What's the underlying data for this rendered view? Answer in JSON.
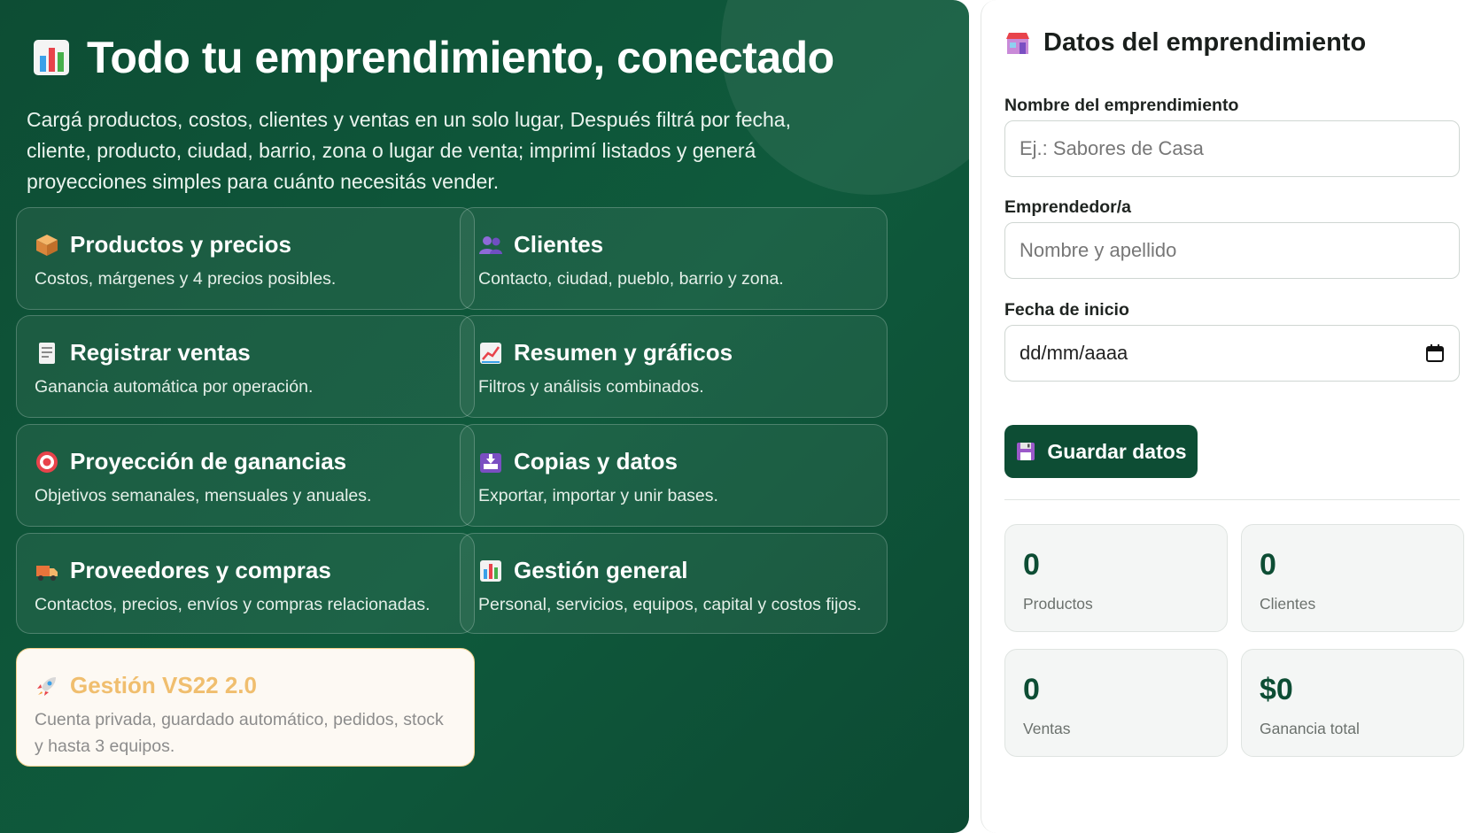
{
  "hero": {
    "title": "Todo tu emprendimiento, conectado",
    "title_icon": "bar-chart-icon",
    "subtitle": "Cargá productos, costos, clientes y ventas en un solo lugar, Después filtrá por fecha, cliente, producto, ciudad, barrio, zona o lugar de venta; imprimí listados y generá proyecciones simples para cuánto necesitás vender."
  },
  "cards": [
    {
      "icon": "package-icon",
      "title": "Productos y precios",
      "desc": "Costos, márgenes y 4 precios posibles."
    },
    {
      "icon": "users-icon",
      "title": "Clientes",
      "desc": "Contacto, ciudad, pueblo, barrio y zona."
    },
    {
      "icon": "receipt-icon",
      "title": "Registrar ventas",
      "desc": "Ganancia automática por operación."
    },
    {
      "icon": "line-chart-icon",
      "title": "Resumen y gráficos",
      "desc": "Filtros y análisis combinados."
    },
    {
      "icon": "target-icon",
      "title": "Proyección de ganancias",
      "desc": "Objetivos semanales, mensuales y anuales."
    },
    {
      "icon": "inbox-tray-icon",
      "title": "Copias y datos",
      "desc": "Exportar, importar y unir bases."
    },
    {
      "icon": "truck-icon",
      "title": "Proveedores y compras",
      "desc": "Contactos, precios, envíos y compras relacionadas."
    },
    {
      "icon": "bar-chart-icon",
      "title": "Gestión general",
      "desc": "Personal, servicios, equipos, capital y costos fijos."
    }
  ],
  "promo": {
    "icon": "rocket-icon",
    "title": "Gestión VS22 2.0",
    "desc": "Cuenta privada, guardado automático, pedidos, stock y hasta 3 equipos."
  },
  "panel": {
    "title": "Datos del emprendimiento",
    "title_icon": "store-icon",
    "name_label": "Nombre del emprendimiento",
    "name_placeholder": "Ej.: Sabores de Casa",
    "owner_label": "Emprendedor/a",
    "owner_placeholder": "Nombre y apellido",
    "date_label": "Fecha de inicio",
    "date_placeholder": "dd/mm/aaaa",
    "save_label": "Guardar datos",
    "save_icon": "floppy-disk-icon"
  },
  "stats": [
    {
      "value": "0",
      "label": "Productos"
    },
    {
      "value": "0",
      "label": "Clientes"
    },
    {
      "value": "0",
      "label": "Ventas"
    },
    {
      "value": "$0",
      "label": "Ganancia total"
    }
  ],
  "colors": {
    "brand_green": "#0d4d34",
    "promo_accent": "#f0be6e"
  }
}
